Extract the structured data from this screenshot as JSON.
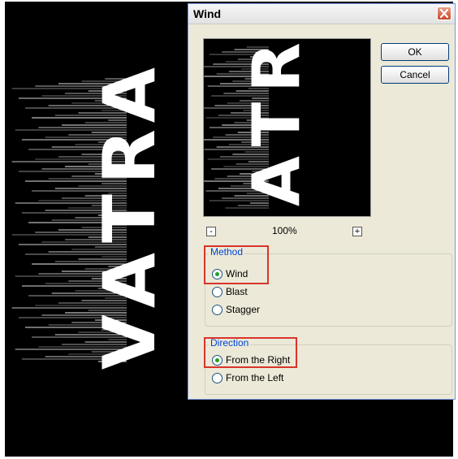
{
  "dialog": {
    "title": "Wind"
  },
  "buttons": {
    "ok": "OK",
    "cancel": "Cancel"
  },
  "preview": {
    "zoom": "100%",
    "zoom_out": "-",
    "zoom_in": "+"
  },
  "canvas_text": [
    "V",
    "A",
    "T",
    "R",
    "A"
  ],
  "preview_text": [
    "A",
    "T",
    "R"
  ],
  "method": {
    "legend": "Method",
    "options": [
      "Wind",
      "Blast",
      "Stagger"
    ],
    "selected": "Wind"
  },
  "direction": {
    "legend": "Direction",
    "options": [
      "From the Right",
      "From the Left"
    ],
    "selected": "From the Right"
  },
  "colors": {
    "highlight": "#d9342b",
    "legend": "#0046d5"
  }
}
